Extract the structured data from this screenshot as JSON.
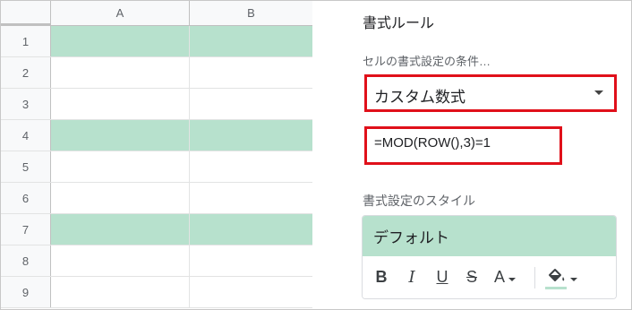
{
  "sheet": {
    "columns": [
      "A",
      "B"
    ],
    "rows": [
      {
        "num": "1",
        "highlighted": true
      },
      {
        "num": "2",
        "highlighted": false
      },
      {
        "num": "3",
        "highlighted": false
      },
      {
        "num": "4",
        "highlighted": true
      },
      {
        "num": "5",
        "highlighted": false
      },
      {
        "num": "6",
        "highlighted": false
      },
      {
        "num": "7",
        "highlighted": true
      },
      {
        "num": "8",
        "highlighted": false
      },
      {
        "num": "9",
        "highlighted": false
      }
    ]
  },
  "panel": {
    "title": "書式ルール",
    "condition_label": "セルの書式設定の条件…",
    "condition_value": "カスタム数式",
    "formula": "=MOD(ROW(),3)=1",
    "style_label": "書式設定のスタイル",
    "style_preview": "デフォルト",
    "toolbar": {
      "bold": "B",
      "italic": "I",
      "underline": "U",
      "strikethrough": "S",
      "text_color": "A"
    }
  },
  "colors": {
    "highlight": "#b7e1cd",
    "annotation_border": "#e0101a"
  }
}
